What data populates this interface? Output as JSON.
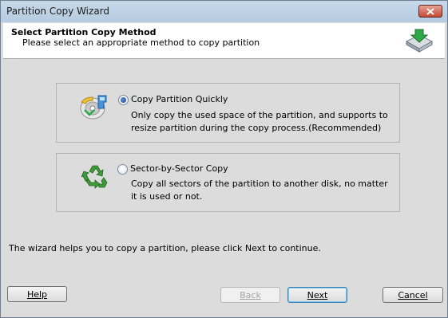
{
  "window": {
    "title": "Partition Copy Wizard",
    "close_label": "close"
  },
  "header": {
    "title": "Select Partition Copy Method",
    "subtitle": "Please select an appropriate method to copy partition"
  },
  "options": [
    {
      "label": "Copy Partition Quickly",
      "selected": true,
      "description": "Only copy the used space of the partition, and supports to resize partition during the copy process.(Recommended)"
    },
    {
      "label": "Sector-by-Sector Copy",
      "selected": false,
      "description": "Copy all sectors of the partition to another disk, no matter it is used or not."
    }
  ],
  "info_text": "The wizard helps you to copy a partition, please click Next to continue.",
  "buttons": {
    "help": "Help",
    "back": "Back",
    "next": "Next",
    "cancel": "Cancel"
  },
  "colors": {
    "titlebar": "#c7d9ea",
    "accent": "#3c7fb1",
    "recycle_green": "#3f9a3a"
  },
  "icons": {
    "header": "disk-download-icon",
    "quick": "disk-copy-icon",
    "sector": "recycle-icon"
  }
}
